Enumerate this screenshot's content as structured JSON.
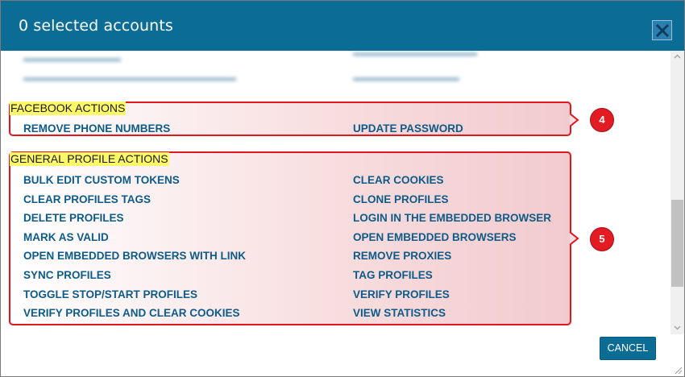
{
  "header": {
    "title": "0 selected accounts",
    "close_icon": "close-icon"
  },
  "facebook_actions": {
    "title": "FACEBOOK ACTIONS",
    "items": [
      "REMOVE PHONE NUMBERS",
      "UPDATE PASSWORD"
    ],
    "badge": "4"
  },
  "general_profile_actions": {
    "title": "GENERAL PROFILE ACTIONS",
    "left_items": [
      "BULK EDIT CUSTOM TOKENS",
      "CLEAR PROFILES TAGS",
      "DELETE PROFILES",
      "MARK AS VALID",
      "OPEN EMBEDDED BROWSERS WITH LINK",
      "SYNC PROFILES",
      "TOGGLE STOP/START PROFILES",
      "VERIFY PROFILES AND CLEAR COOKIES"
    ],
    "right_items": [
      "CLEAR COOKIES",
      "CLONE PROFILES",
      "LOGIN IN THE EMBEDDED BROWSER",
      "OPEN EMBEDDED BROWSERS",
      "REMOVE PROXIES",
      "TAG PROFILES",
      "VERIFY PROFILES",
      "VIEW STATISTICS"
    ],
    "badge": "5"
  },
  "footer": {
    "cancel_label": "CANCEL"
  },
  "colors": {
    "header_bg": "#0b6d96",
    "link": "#0c5b88",
    "highlight": "#fdf86a",
    "callout": "#e2161f"
  }
}
